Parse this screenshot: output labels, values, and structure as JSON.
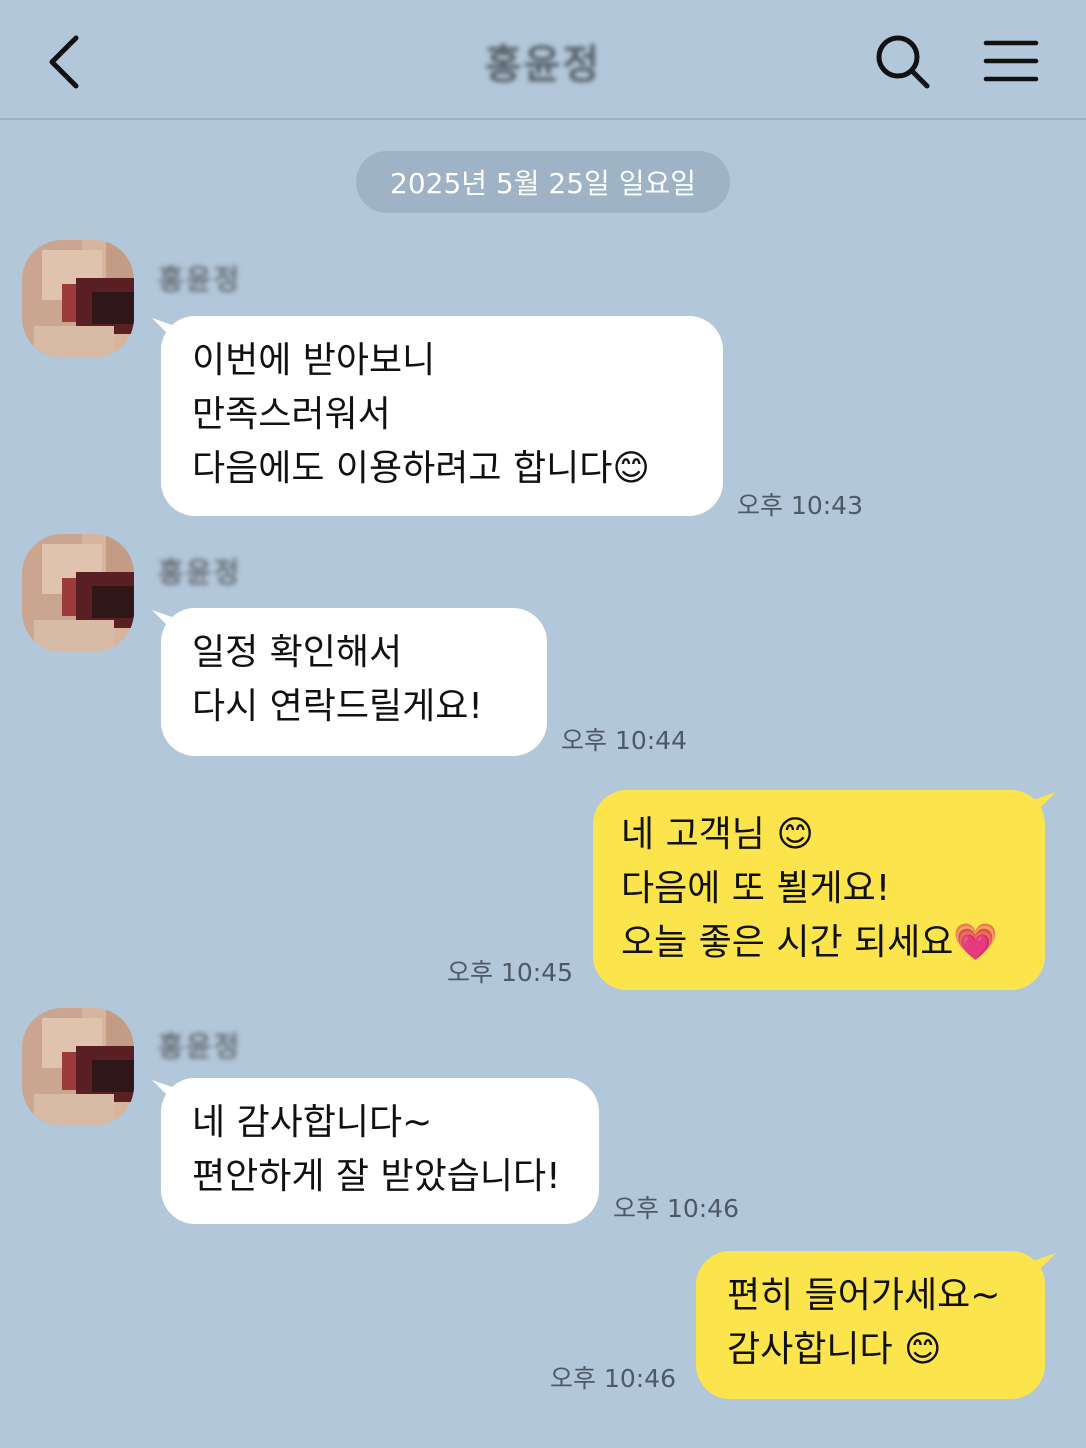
{
  "header": {
    "title": "홍윤정",
    "back_icon": "chevron-left-icon",
    "search_icon": "search-icon",
    "menu_icon": "hamburger-menu-icon"
  },
  "date_divider": "2025년 5월 25일 일요일",
  "messages": [
    {
      "direction": "incoming",
      "sender": "홍윤정",
      "lines": [
        "이번에 받아보니",
        "만족스러워서",
        "다음에도 이용하려고 합니다😊"
      ],
      "time": "오후 10:43"
    },
    {
      "direction": "incoming",
      "sender": "홍윤정",
      "lines": [
        "일정 확인해서",
        "다시 연락드릴게요!"
      ],
      "time": "오후 10:44"
    },
    {
      "direction": "outgoing",
      "lines": [
        "네 고객님 😊",
        "다음에 또 뵐게요!",
        "오늘 좋은 시간 되세요💗"
      ],
      "time": "오후 10:45"
    },
    {
      "direction": "incoming",
      "sender": "홍윤정",
      "lines": [
        "네 감사합니다~",
        "편안하게 잘 받았습니다!"
      ],
      "time": "오후 10:46"
    },
    {
      "direction": "outgoing",
      "lines": [
        "편히 들어가세요~",
        "감사합니다 😊"
      ],
      "time": "오후 10:46"
    }
  ],
  "colors": {
    "background": "#b2c7da",
    "incoming_bubble": "#ffffff",
    "outgoing_bubble": "#fbe44c",
    "date_pill": "#9eb3c6"
  }
}
